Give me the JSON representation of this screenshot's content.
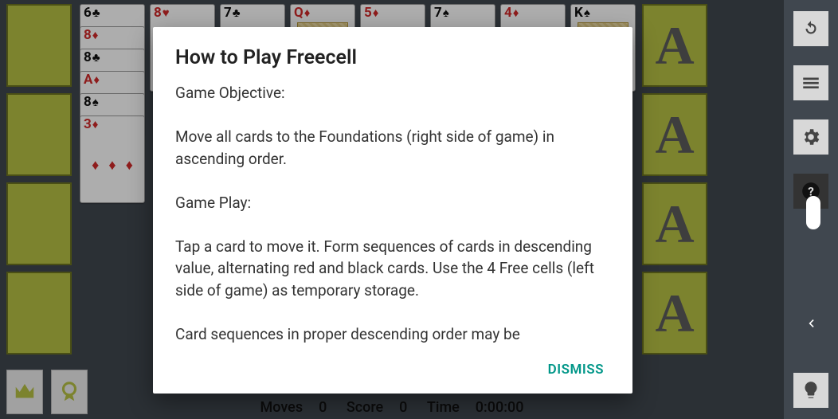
{
  "foundation_letter": "A",
  "tableau": [
    [
      {
        "rank": "6",
        "suit": "♣",
        "color": "black"
      },
      {
        "rank": "8",
        "suit": "♦",
        "color": "red"
      },
      {
        "rank": "8",
        "suit": "♣",
        "color": "black"
      },
      {
        "rank": "A",
        "suit": "♦",
        "color": "red"
      },
      {
        "rank": "8",
        "suit": "♠",
        "color": "black"
      },
      {
        "rank": "3",
        "suit": "♦",
        "color": "red"
      }
    ],
    [
      {
        "rank": "8",
        "suit": "♥",
        "color": "red"
      }
    ],
    [
      {
        "rank": "7",
        "suit": "♣",
        "color": "black"
      }
    ],
    [
      {
        "rank": "Q",
        "suit": "♦",
        "color": "red",
        "face": true
      }
    ],
    [
      {
        "rank": "5",
        "suit": "♦",
        "color": "red"
      }
    ],
    [
      {
        "rank": "7",
        "suit": "♠",
        "color": "black"
      }
    ],
    [
      {
        "rank": "4",
        "suit": "♦",
        "color": "red"
      }
    ],
    [
      {
        "rank": "K",
        "suit": "♠",
        "color": "black",
        "face": true
      }
    ]
  ],
  "status": {
    "moves_label": "Moves",
    "moves_value": "0",
    "score_label": "Score",
    "score_value": "0",
    "time_label": "Time",
    "time_value": "0:00:00"
  },
  "dialog": {
    "title": "How to Play Freecell",
    "body": "Game Objective:\n\n Move all cards to the Foundations (right side of game) in ascending order.\n\n Game Play:\n\n Tap a card to move it. Form sequences of cards in descending value, alternating red and black cards. Use the 4 Free cells (left side of game) as temporary storage.\n\n Card sequences in proper descending order may be",
    "dismiss_label": "DISMISS"
  }
}
